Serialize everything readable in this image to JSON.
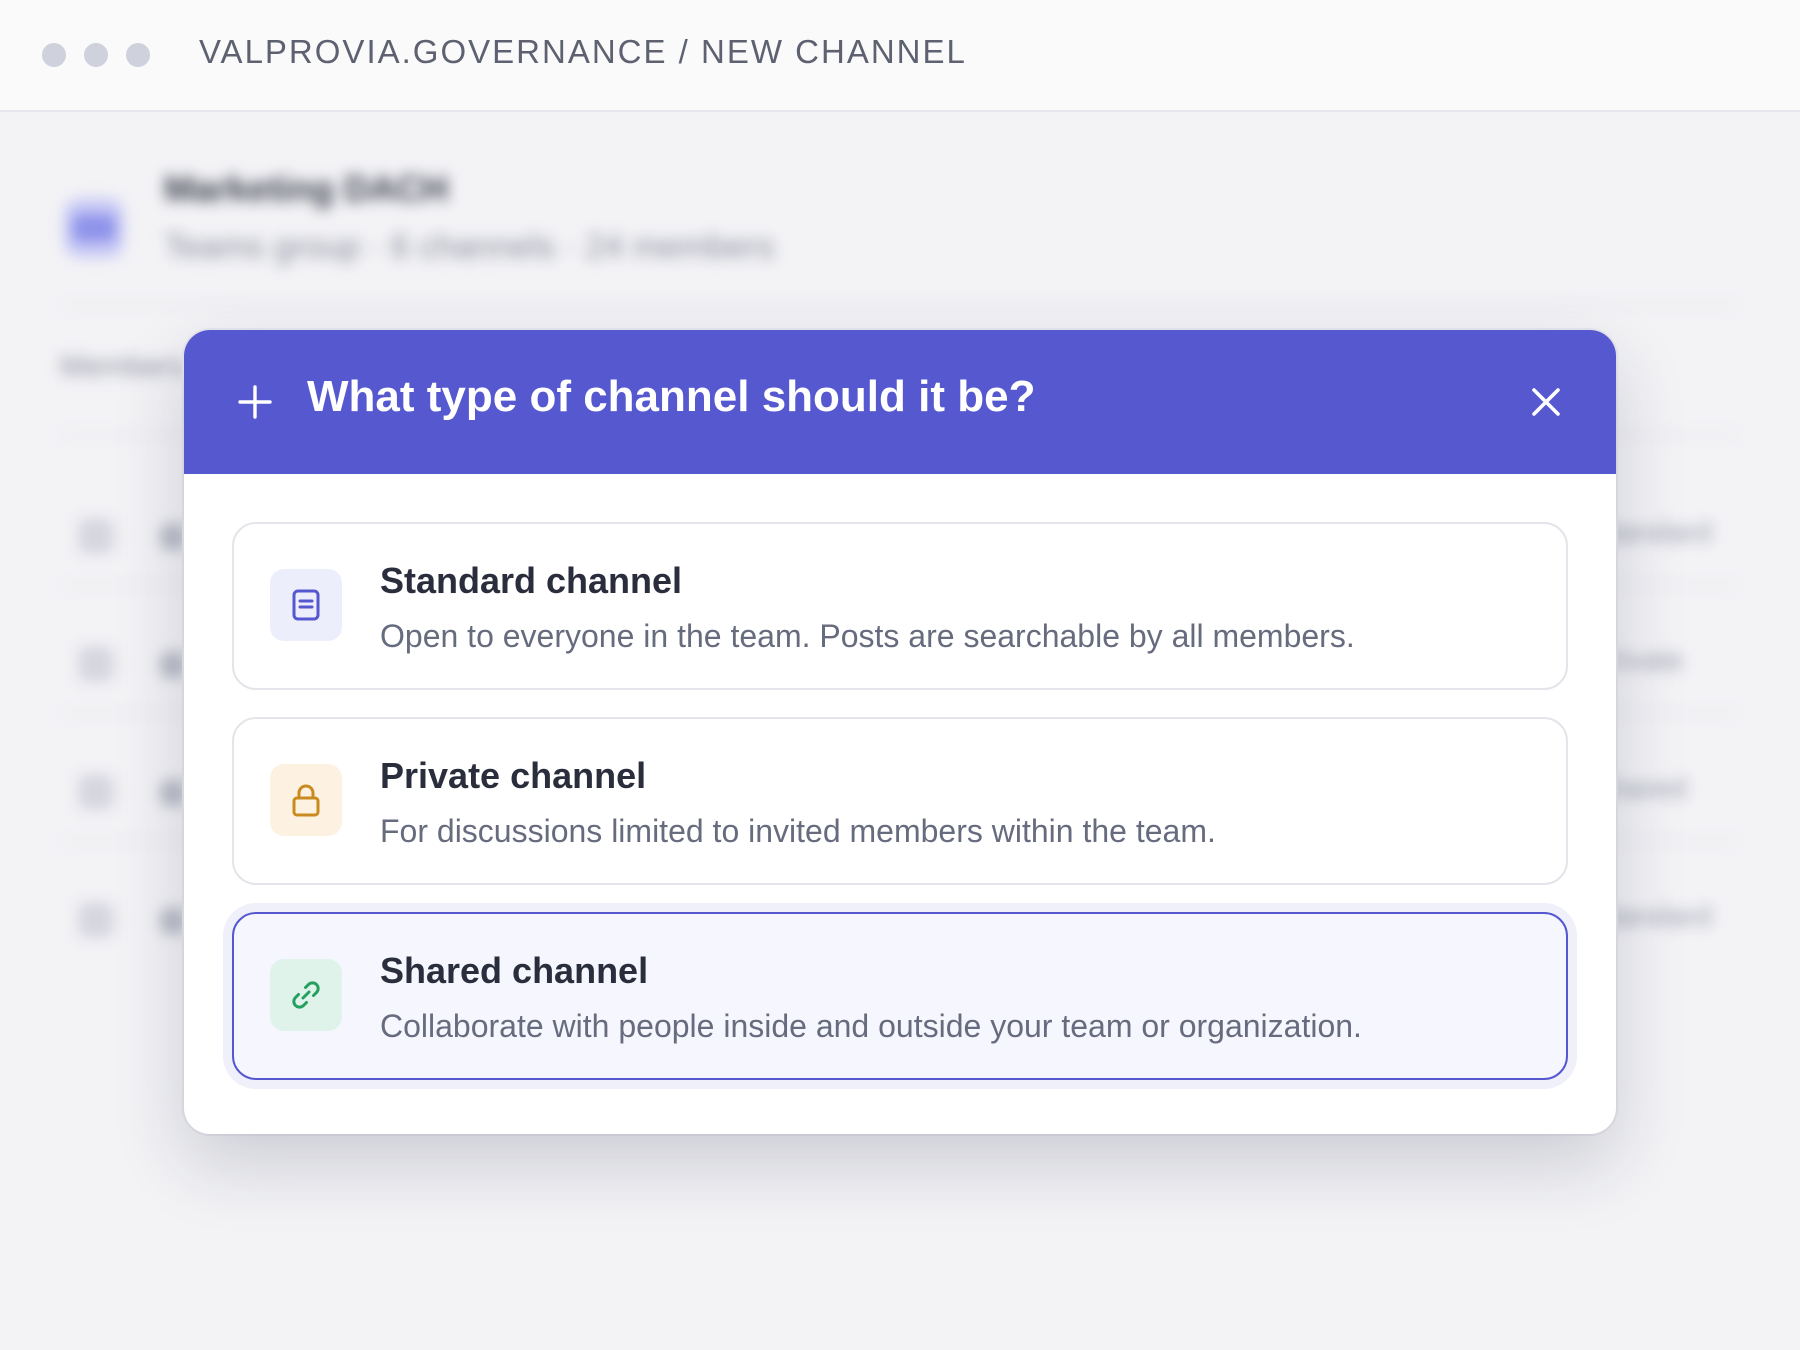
{
  "window": {
    "breadcrumb": "VALPROVIA.GOVERNANCE / NEW CHANNEL"
  },
  "background": {
    "group_name": "Marketing DACH",
    "group_meta": "Teams group · 6 channels · 24 members",
    "section_label": "Members",
    "rows": [
      {
        "status": "Standard"
      },
      {
        "status": "Private"
      },
      {
        "status": "Shared"
      },
      {
        "status": "Standard"
      }
    ]
  },
  "modal": {
    "title": "What type of channel should it be?",
    "accent_color": "#5558cf",
    "options": [
      {
        "title": "Standard channel",
        "description": "Open to everyone in the team. Posts are searchable by all members.",
        "icon": "document-icon",
        "icon_color": "#5558cf",
        "icon_bg": "#eceefc"
      },
      {
        "title": "Private channel",
        "description": "For discussions limited to invited members within the team.",
        "icon": "lock-icon",
        "icon_color": "#c98a1e",
        "icon_bg": "#fdf1e1"
      },
      {
        "title": "Shared channel",
        "description": "Collaborate with people inside and outside your team or organization.",
        "icon": "link-icon",
        "icon_color": "#24a05e",
        "icon_bg": "#dff3ea",
        "selected": true
      }
    ]
  }
}
